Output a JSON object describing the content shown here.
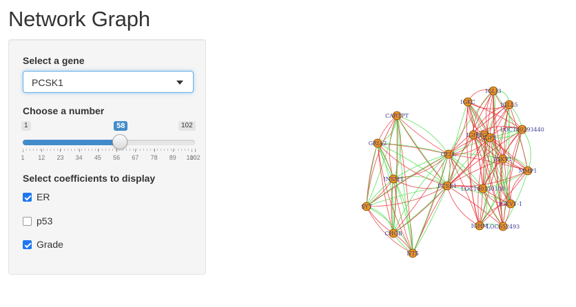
{
  "title": "Network Graph",
  "gene_select": {
    "label": "Select a gene",
    "value": "PCSK1"
  },
  "number_slider": {
    "label": "Choose a number",
    "min": 1,
    "max": 102,
    "value": 58,
    "grid": [
      "1",
      "12",
      "23",
      "34",
      "45",
      "56",
      "67",
      "78",
      "89",
      "100",
      "102"
    ]
  },
  "coefficients": {
    "label": "Select coefficients to display",
    "options": [
      {
        "label": "ER",
        "checked": true
      },
      {
        "label": "p53",
        "checked": false
      },
      {
        "label": "Grade",
        "checked": true
      }
    ]
  },
  "network": {
    "node_color": "#f0961e",
    "edge_colors": {
      "positive": "#3ddc3d",
      "negative": "#e8242c"
    },
    "nodes": [
      {
        "id": "CARTPT",
        "label": "CARTPT"
      },
      {
        "id": "GRIA2",
        "label": "GRIA2"
      },
      {
        "id": "INSM1",
        "label": "INSM1"
      },
      {
        "id": "SYT",
        "label": "SYT"
      },
      {
        "id": "CHGB",
        "label": "CHGB"
      },
      {
        "id": "NTS",
        "label": "NTS"
      },
      {
        "id": "PCSK1",
        "label": "PCSK1"
      },
      {
        "id": "CELL",
        "label": "CELL"
      },
      {
        "id": "IGLJ3",
        "label": "IGLJ3"
      },
      {
        "id": "IGKC",
        "label": "IGKC"
      },
      {
        "id": "IGLL5",
        "label": "IGLL5"
      },
      {
        "id": "LOC100293440",
        "label": "LOC100293440"
      },
      {
        "id": "IGHJ",
        "label": "IGHJ"
      },
      {
        "id": "IGJ",
        "label": "IGJ"
      },
      {
        "id": "IGKV1",
        "label": "IGKV1"
      },
      {
        "id": "IGF1",
        "label": "IGF1"
      },
      {
        "id": "MMP1",
        "label": "MMP1"
      },
      {
        "id": "LOC100130100",
        "label": "LOC100130100"
      },
      {
        "id": "IGKV1-1",
        "label": "IGKV1-1"
      },
      {
        "id": "IGHM",
        "label": "IGHM"
      },
      {
        "id": "LOC652493",
        "label": "LOC652493"
      }
    ]
  }
}
